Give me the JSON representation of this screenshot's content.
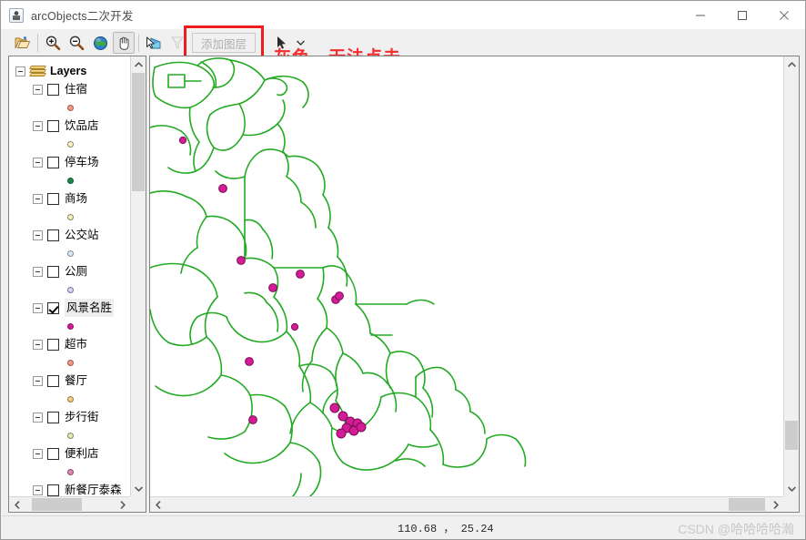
{
  "window": {
    "title": "arcObjects二次开发",
    "icon": "java-app-icon",
    "controls": [
      {
        "name": "minimize-button",
        "glyph": "—"
      },
      {
        "name": "maximize-button",
        "glyph": "□"
      },
      {
        "name": "close-button",
        "glyph": "✕"
      }
    ]
  },
  "toolbar": {
    "buttons": [
      {
        "name": "open-folder-button",
        "icon": "open-folder-icon",
        "tooltip": "打开",
        "state": "enabled"
      },
      {
        "name": "zoom-in-button",
        "icon": "zoom-in-icon",
        "tooltip": "放大",
        "state": "enabled"
      },
      {
        "name": "zoom-out-button",
        "icon": "zoom-out-icon",
        "tooltip": "缩小",
        "state": "enabled"
      },
      {
        "name": "full-extent-button",
        "icon": "globe-icon",
        "tooltip": "全图",
        "state": "enabled"
      },
      {
        "name": "pan-button",
        "icon": "hand-icon",
        "tooltip": "漫游",
        "state": "pressed"
      },
      {
        "name": "identify-button",
        "icon": "identify-arrow-icon",
        "tooltip": "识别",
        "state": "enabled"
      },
      {
        "name": "select-features-button",
        "icon": "select-polygon-icon",
        "tooltip": "选择",
        "state": "disabled"
      }
    ],
    "add_layer_label": "添加图层",
    "add_layer_state": "disabled",
    "select-arrow-icon": "cursor-arrow-icon",
    "dropdown-caret-icon": "chevron-down-icon"
  },
  "annotation": {
    "text": "灰色，无法点击",
    "color": "#f42d2d"
  },
  "toc": {
    "root": {
      "label": "Layers",
      "icon": "layers-stack-icon",
      "expanded": true
    },
    "layers": [
      {
        "label": "住宿",
        "checked": false,
        "symbol_color": "#f09a8a",
        "symbol_border": "#a05a4a"
      },
      {
        "label": "饮品店",
        "checked": false,
        "symbol_color": "#fdf5cf",
        "symbol_border": "#8a8560"
      },
      {
        "label": "停车场",
        "checked": false,
        "symbol_color": "#1a8a4a",
        "symbol_border": "#0d5a2e"
      },
      {
        "label": "商场",
        "checked": false,
        "symbol_color": "#f2f0c0",
        "symbol_border": "#8a8750"
      },
      {
        "label": "公交站",
        "checked": false,
        "symbol_color": "#dfe9f5",
        "symbol_border": "#7a8a9a"
      },
      {
        "label": "公厕",
        "checked": false,
        "symbol_color": "#dcd4ef",
        "symbol_border": "#7a72a0"
      },
      {
        "label": "风景名胜",
        "checked": true,
        "symbol_color": "#d41c96",
        "symbol_border": "#8a1166",
        "selected": true
      },
      {
        "label": "超市",
        "checked": false,
        "symbol_color": "#f0998a",
        "symbol_border": "#a0574a"
      },
      {
        "label": "餐厅",
        "checked": false,
        "symbol_color": "#f2cd86",
        "symbol_border": "#9a7a42"
      },
      {
        "label": "步行街",
        "checked": false,
        "symbol_color": "#dfe8b8",
        "symbol_border": "#808a5a"
      },
      {
        "label": "便利店",
        "checked": false,
        "symbol_color": "#d98ab0",
        "symbol_border": "#8a4a68"
      },
      {
        "label": "新餐厅泰森",
        "checked": false,
        "symbol_color": "#1a8a4a",
        "symbol_border": "#0d5a2e"
      }
    ],
    "scroll": {
      "vertical_thumb_position": "top",
      "horizontal_thumb_position": "left"
    }
  },
  "map": {
    "road_color": "#22aa22",
    "point_color": "#d41c96",
    "point_border": "#7a0d56",
    "background": "#ffffff",
    "visible_layer": "风景名胜",
    "scroll": {
      "vertical_thumb_position": "lower",
      "horizontal_thumb_position": "right"
    }
  },
  "statusbar": {
    "coordinates": "110.68 ，  25.24",
    "watermark": "CSDN @哈哈哈哈瀚"
  }
}
